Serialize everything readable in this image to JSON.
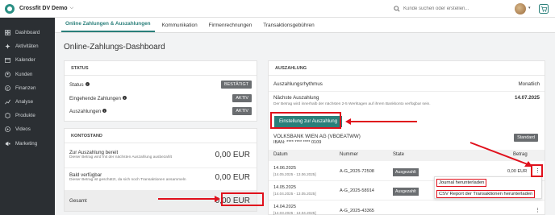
{
  "header": {
    "app_title": "Crossfit DV Demo",
    "search_placeholder": "Kunde suchen oder erstellen..."
  },
  "sidebar": {
    "items": [
      {
        "label": "Dashboard",
        "icon": "dashboard-icon"
      },
      {
        "label": "Aktivitäten",
        "icon": "activities-icon"
      },
      {
        "label": "Kalender",
        "icon": "calendar-icon"
      },
      {
        "label": "Kunden",
        "icon": "customers-icon"
      },
      {
        "label": "Finanzen",
        "icon": "finance-icon"
      },
      {
        "label": "Analyse",
        "icon": "analysis-icon"
      },
      {
        "label": "Produkte",
        "icon": "products-icon"
      },
      {
        "label": "Videos",
        "icon": "videos-icon"
      },
      {
        "label": "Marketing",
        "icon": "marketing-icon"
      }
    ]
  },
  "tabs": [
    {
      "label": "Online Zahlungen & Auszahlungen",
      "active": true
    },
    {
      "label": "Kommunikation",
      "active": false
    },
    {
      "label": "Firmenrechnungen",
      "active": false
    },
    {
      "label": "Transaktionsgebühren",
      "active": false
    }
  ],
  "page_title": "Online-Zahlungs-Dashboard",
  "status_card": {
    "title": "STATUS",
    "rows": [
      {
        "label": "Status",
        "badge": "BESTÄTIGT"
      },
      {
        "label": "Eingehende Zahlungen",
        "badge": "AKTIV"
      },
      {
        "label": "Auszahlungen",
        "badge": "AKTIV"
      }
    ]
  },
  "balance_card": {
    "title": "KONTOSTAND",
    "ready_label": "Zur Auszahlung bereit",
    "ready_sub": "Dieser Betrag wird mit der nächsten Auszahlung ausbezahlt",
    "ready_value": "0,00 EUR",
    "soon_label": "Bald verfügbar",
    "soon_sub": "Dieser Betrag ist geschätzt, da sich noch Transaktionen ansammeln",
    "soon_value": "0,00 EUR",
    "total_label": "Gesamt",
    "total_value": "0,00 EUR"
  },
  "payout_card": {
    "title": "AUSZAHLUNG",
    "rhythm_label": "Auszahlungsrhythmus",
    "rhythm_value": "Monatlich",
    "next_label": "Nächste Auszahlung",
    "next_value": "14.07.2025",
    "next_sub": "Der Betrag wird innerhalb der nächsten 2-5 Werktagen auf ihrem Bankkonto verfügbar sein.",
    "settings_button": "Einstellung zur Auszahlung",
    "bank_name": "VOLKSBANK WIEN AG (VBOEATWW)",
    "iban": "IBAN: **** **** **** 0109",
    "bank_badge": "Standard",
    "table_headers": {
      "date": "Datum",
      "number": "Nummer",
      "state": "State",
      "amount": "Betrag"
    },
    "rows": [
      {
        "date": "14.06.2025",
        "range": "[14.05.2025 - 13.06.2025]",
        "number": "A-G_2025-72508",
        "state": "Ausgezahlt",
        "amount": "0,00 EUR"
      },
      {
        "date": "14.05.2025",
        "range": "[14.04.2025 - 13.05.2025]",
        "number": "A-G_2025-58914",
        "state": "Ausgezahlt",
        "amount": ""
      },
      {
        "date": "14.04.2025",
        "range": "[14.03.2025 - 13.04.2025]",
        "number": "A-G_2025-43365",
        "state": "",
        "amount": ""
      }
    ],
    "menu": {
      "item1": "Journal herunterladen",
      "item2": "CSV Report der Transaktionen herunterladen"
    }
  },
  "colors": {
    "accent": "#2a7f7a",
    "sidebar_bg": "#2b2f33",
    "annotation_red": "#e0101c"
  }
}
